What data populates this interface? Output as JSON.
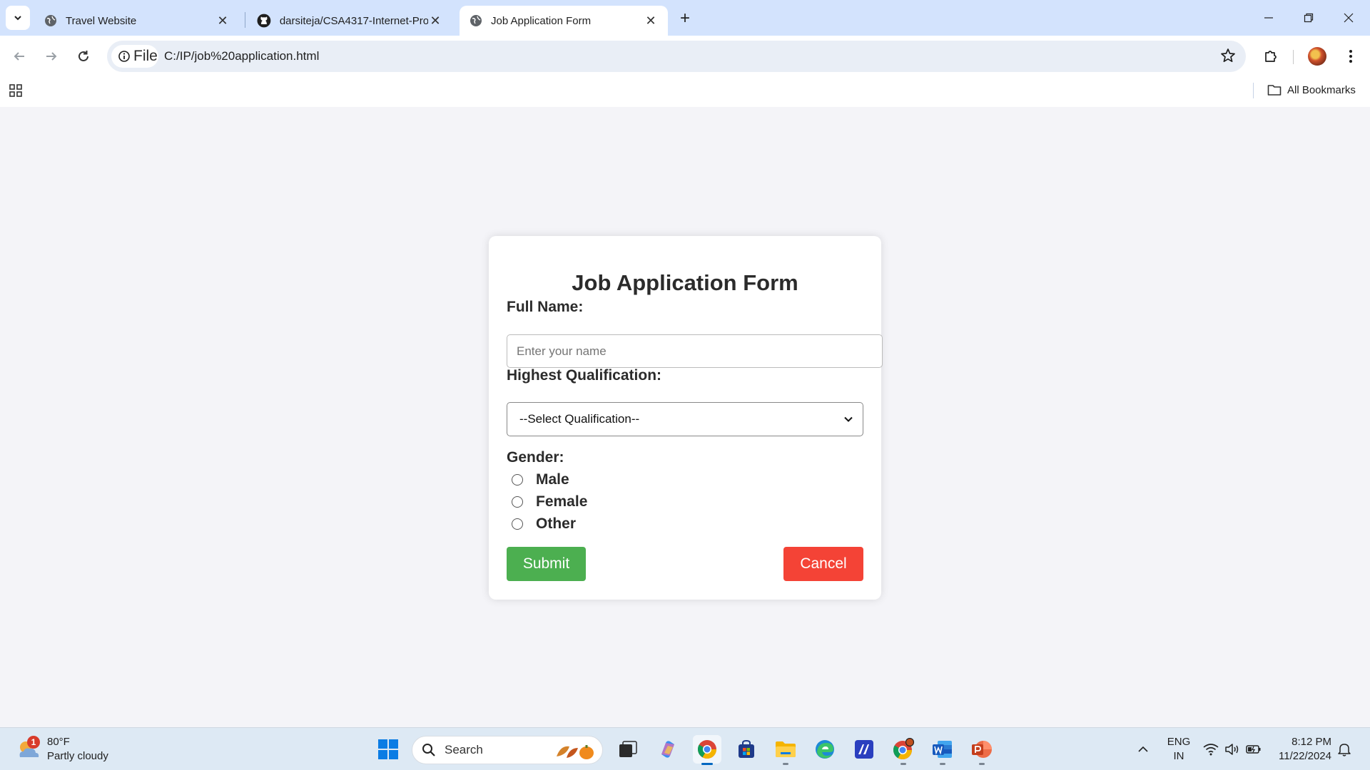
{
  "browser": {
    "tabs": [
      {
        "title": "Travel Website",
        "icon": "globe-icon"
      },
      {
        "title": "darsiteja/CSA4317-Internet-Pro",
        "icon": "github-icon"
      },
      {
        "title": "Job Application Form",
        "icon": "globe-icon",
        "active": true
      }
    ],
    "address": {
      "chip_label": "File",
      "url": "C:/IP/job%20application.html"
    },
    "bookmarks": {
      "all_label": "All Bookmarks"
    }
  },
  "form": {
    "title": "Job Application Form",
    "full_name_label": "Full Name:",
    "full_name_placeholder": "Enter your name",
    "qualification_label": "Highest Qualification:",
    "qualification_selected": "--Select Qualification--",
    "gender_label": "Gender:",
    "gender_options": [
      "Male",
      "Female",
      "Other"
    ],
    "submit_label": "Submit",
    "cancel_label": "Cancel",
    "colors": {
      "submit": "#4caf50",
      "cancel": "#f44336"
    }
  },
  "taskbar": {
    "weather": {
      "temp": "80°F",
      "condition": "Partly cloudy",
      "badge": "1"
    },
    "search_label": "Search",
    "language": {
      "line1": "ENG",
      "line2": "IN"
    },
    "clock": {
      "time": "8:12 PM",
      "date": "11/22/2024"
    }
  }
}
